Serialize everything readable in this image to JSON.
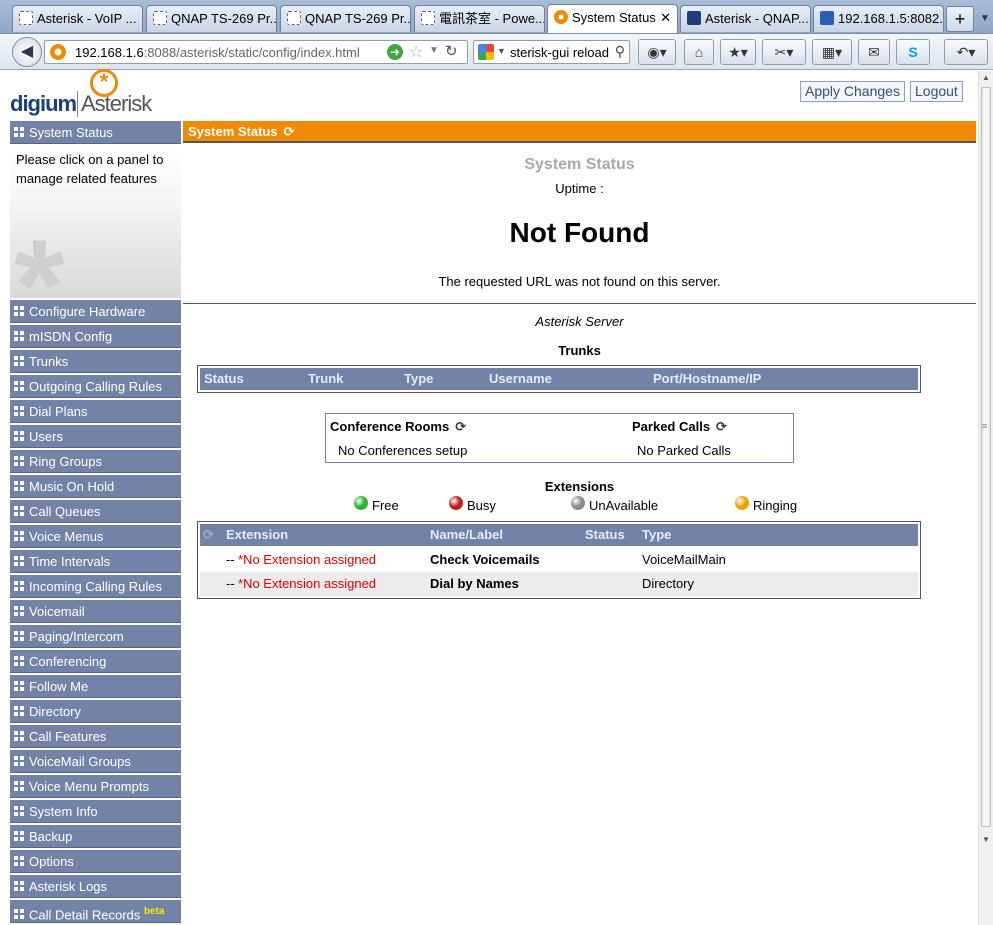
{
  "browser": {
    "tabs": [
      {
        "label": "Asterisk - VoIP ...",
        "icon": "dashed"
      },
      {
        "label": "QNAP TS-269 Pr...",
        "icon": "dashed"
      },
      {
        "label": "QNAP TS-269 Pr...",
        "icon": "dashed"
      },
      {
        "label": "電訊茶室 - Powe...",
        "icon": "dashed"
      },
      {
        "label": "System Status",
        "icon": "orange",
        "active": true
      },
      {
        "label": "Asterisk - QNAP...",
        "icon": "qnap"
      },
      {
        "label": "192.168.1.5:8082...",
        "icon": "blue"
      }
    ],
    "new_tab": "+",
    "url_host": "192.168.1.6",
    "url_rest": ":8088/asterisk/static/config/index.html",
    "search_text": "sterisk-gui reload"
  },
  "header": {
    "logo_left": "digium",
    "logo_right": "Asterisk",
    "apply_label": "Apply Changes",
    "logout_label": "Logout"
  },
  "sidebar": {
    "active_label": "System Status",
    "help_text": "Please click on a panel to manage related features",
    "items": [
      "Configure Hardware",
      "mISDN Config",
      "Trunks",
      "Outgoing Calling Rules",
      "Dial Plans",
      "Users",
      "Ring Groups",
      "Music On Hold",
      "Call Queues",
      "Voice Menus",
      "Time Intervals",
      "Incoming Calling Rules",
      "Voicemail",
      "Paging/Intercom",
      "Conferencing",
      "Follow Me",
      "Directory",
      "Call Features",
      "VoiceMail Groups",
      "Voice Menu Prompts",
      "System Info",
      "Backup",
      "Options",
      "Asterisk Logs"
    ],
    "last_item": "Call Detail Records",
    "last_item_badge": "beta"
  },
  "main": {
    "heading": "System Status",
    "title": "System Status",
    "uptime": "Uptime :",
    "not_found": "Not Found",
    "not_found_msg": "The requested URL was not found on this server.",
    "server_label": "Asterisk Server",
    "trunks_title": "Trunks",
    "trunk_columns": [
      "Status",
      "Trunk",
      "Type",
      "Username",
      "Port/Hostname/IP"
    ],
    "conference": {
      "title": "Conference Rooms",
      "value": "No Conferences setup"
    },
    "parked": {
      "title": "Parked Calls",
      "value": "No Parked Calls"
    },
    "extensions_title": "Extensions",
    "legend": [
      {
        "label": "Free",
        "color": "#2db32d"
      },
      {
        "label": "Busy",
        "color": "#c0201a"
      },
      {
        "label": "UnAvailable",
        "color": "#8a8a8a"
      },
      {
        "label": "Ringing",
        "color": "#f0a000"
      }
    ],
    "ext_columns": [
      "Extension",
      "Name/Label",
      "Status",
      "Type"
    ],
    "ext_rows": [
      {
        "prefix": "--",
        "extension": "*No Extension assigned",
        "name": "Check Voicemails",
        "status": "",
        "type": "VoiceMailMain"
      },
      {
        "prefix": "--",
        "extension": "*No Extension assigned",
        "name": "Dial by Names",
        "status": "",
        "type": "Directory"
      }
    ]
  },
  "colors": {
    "accent": "#f08a00",
    "nav": "#7383a8",
    "error": "#e00000"
  }
}
